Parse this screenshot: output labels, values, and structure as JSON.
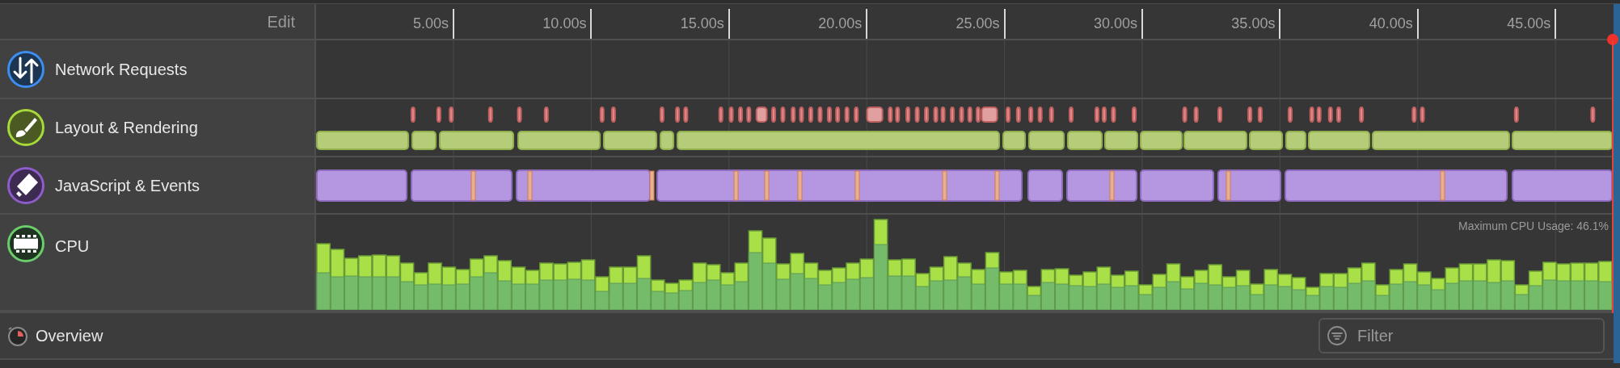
{
  "header": {
    "edit_button": "Edit"
  },
  "ruler": {
    "ticks": [
      "5.00s",
      "10.00s",
      "15.00s",
      "20.00s",
      "25.00s",
      "30.00s",
      "35.00s",
      "40.00s",
      "45.00s"
    ]
  },
  "tracks": [
    {
      "kind": "network",
      "label": "Network Requests"
    },
    {
      "kind": "layout",
      "label": "Layout & Rendering"
    },
    {
      "kind": "javascript",
      "label": "JavaScript & Events"
    },
    {
      "kind": "cpu",
      "label": "CPU",
      "caption": "Maximum CPU Usage: 46.1%"
    }
  ],
  "footer": {
    "overview": "Overview",
    "filter_placeholder": "Filter"
  }
}
